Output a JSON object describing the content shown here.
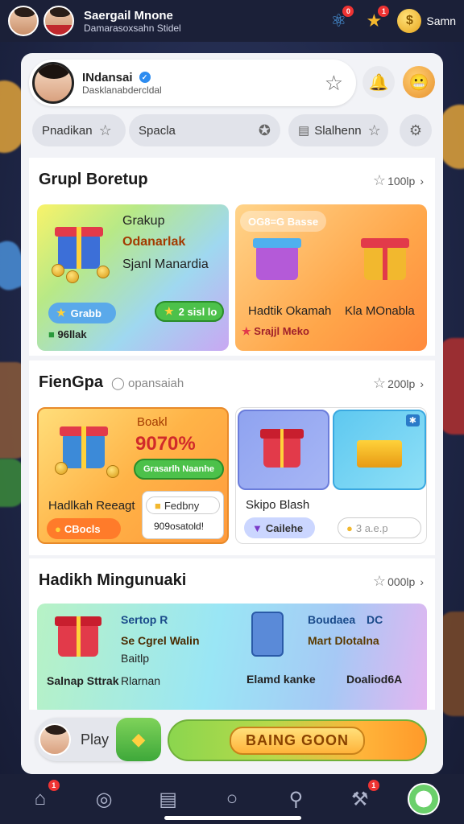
{
  "header": {
    "title": "Saergail Mnone",
    "subtitle": "Damarasoxsahn Stidel",
    "currency_label": "Samn"
  },
  "profile": {
    "name": "INdansai",
    "subtitle": "Dasklanabdercldal"
  },
  "chips": [
    {
      "label": "Pnadikan"
    },
    {
      "label": "Spacla"
    },
    {
      "label": "Slalhenn"
    }
  ],
  "sections": {
    "s1": {
      "title": "Grupl Boretup",
      "more": "100lp",
      "tile1": {
        "line1": "Grakup",
        "line2": "Odanarlak",
        "line3": "Sjanl Manardia",
        "pill1": "Grabb",
        "pill2": "2 sisl lo",
        "foot": "96llak"
      },
      "tile2": {
        "pill": "OG8=G Basse",
        "label1": "Hadtik Okamah",
        "label2": "Kla MOnabla",
        "foot": "Srajjl Meko"
      }
    },
    "s2": {
      "title": "FienGpa",
      "sub": "opansaiah",
      "more": "200lp",
      "tile1": {
        "line1": "Boakl",
        "line2": "9070%",
        "pill": "Grasarlh Naanhe",
        "label": "Hadlkah Reeagt",
        "pill_orange": "CBocls",
        "box1": "Fedbny",
        "box2": "909osatold!"
      },
      "tile2": {
        "label": "Skipo Blash",
        "pill": "Cailehe",
        "pill2": "3 a.e.p"
      }
    },
    "s3": {
      "title": "Hadikh Mingunuaki",
      "more": "000lp",
      "tile": {
        "l1": "Sertop R",
        "l2": "Se Cgrel Walin",
        "l3": "Baitlp",
        "l4": "Salnap Sttrak",
        "l5": "Rlarnan",
        "r1": "Boudaea",
        "r1b": "DC",
        "r2": "Mart Dlotalna",
        "r3": "Elamd kanke",
        "r4": "Doaliod6A"
      }
    }
  },
  "cta": {
    "play_label": "Play",
    "main_label": "BAING GOON"
  },
  "badges": {
    "top1": "0",
    "top2": "1",
    "nav1": "1",
    "nav6": "1"
  },
  "colors": {
    "topbar": "#1b2038",
    "panel": "#f2f3f7",
    "accent_green": "#4cc14a",
    "accent_orange": "#ff9a2a"
  }
}
